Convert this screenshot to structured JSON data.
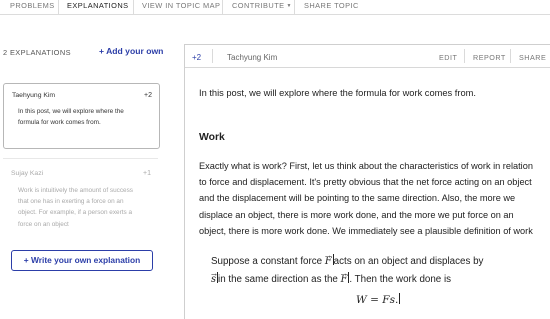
{
  "tabs": [
    {
      "label": "PROBLEMS",
      "active": false
    },
    {
      "label": "EXPLANATIONS",
      "active": true
    },
    {
      "label": "VIEW IN TOPIC MAP",
      "active": false
    },
    {
      "label": "CONTRIBUTE",
      "active": false,
      "has_dropdown": true
    },
    {
      "label": "SHARE TOPIC",
      "active": false
    }
  ],
  "sidebar": {
    "count_label": "2 EXPLANATIONS",
    "add_label": "+ Add your own",
    "cards": [
      {
        "author": "Taehyung Kim",
        "score": "+2",
        "snippet": "In this post, we will explore where the formula for work comes from.",
        "selected": true
      },
      {
        "author": "Sujay Kazi",
        "score": "+1",
        "snippet": "Work is intuitively the amount of success that one has in exerting a force on an object. For example, if a person exerts a force on an object",
        "selected": false
      }
    ],
    "write_label": "+ Write your own explanation"
  },
  "post": {
    "score": "+2",
    "author": "Tachyung Kim",
    "actions": {
      "edit": "EDIT",
      "report": "REPORT",
      "share": "SHARE"
    },
    "intro": "In this post, we will explore where the formula for work comes from.",
    "heading": "Work",
    "paragraph": "Exactly what is work? First, let us think about the characteristics of work in relation to force and displacement. It's pretty obvious that the net force acting on an object and the displacement will be pointing to the same direction. Also, the more we displace an object, there is more work done, and the more we put force on an object, there is more work done. We immediately see a plausible definition of work",
    "box": {
      "line1_a": "Suppose a constant force ",
      "line1_var": "F",
      "line1_b": "acts on an object and displaces by",
      "line2_var": "s",
      "line2_a": "in the same direction as the ",
      "line2_var2": "F",
      "line2_b": ". Then the work done is",
      "formula_lhs": "W",
      "formula_eq": " = ",
      "formula_rhs": "Fs.",
      "arrow_symbol": "→"
    }
  },
  "colors": {
    "accent": "#2c3ea8",
    "muted": "#aaaaaa",
    "border": "#cfcfcf"
  }
}
